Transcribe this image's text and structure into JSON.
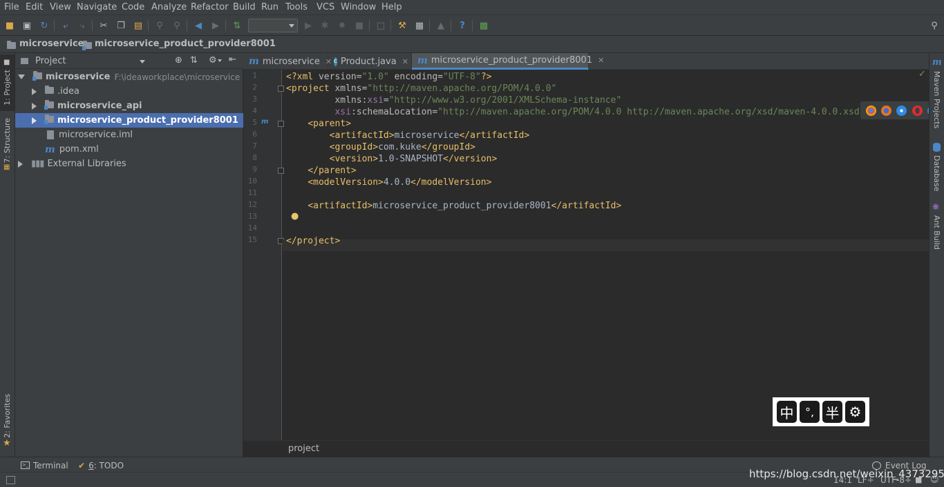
{
  "menu": [
    "File",
    "Edit",
    "View",
    "Navigate",
    "Code",
    "Analyze",
    "Refactor",
    "Build",
    "Run",
    "Tools",
    "VCS",
    "Window",
    "Help"
  ],
  "toolbar": {
    "run_config_value": ""
  },
  "navbar": {
    "crumbs": [
      "microservice",
      "microservice_product_provider8001"
    ]
  },
  "left_tabs": {
    "project": "1: Project",
    "structure": "7: Structure",
    "favorites": "2: Favorites"
  },
  "project_panel": {
    "title": "Project",
    "tree": [
      {
        "name": "microservice",
        "detail": "F:\\ideaworkplace\\microservice"
      },
      {
        "name": ".idea"
      },
      {
        "name": "microservice_api"
      },
      {
        "name": "microservice_product_provider8001"
      },
      {
        "name": "microservice.iml"
      },
      {
        "name": "pom.xml"
      },
      {
        "name": "External Libraries"
      }
    ]
  },
  "editor": {
    "tabs": [
      {
        "label": "microservice",
        "icon": "maven-icon"
      },
      {
        "label": "Product.java",
        "icon": "class-icon"
      },
      {
        "label": "microservice_product_provider8001",
        "icon": "maven-icon"
      }
    ],
    "line_numbers": [
      "1",
      "2",
      "3",
      "4",
      "5",
      "6",
      "7",
      "8",
      "9",
      "10",
      "11",
      "12",
      "13",
      "14",
      "15"
    ],
    "breadcrumb": "project"
  },
  "right_tabs": {
    "maven": "Maven Projects",
    "database": "Database",
    "ant": "Ant Build"
  },
  "bottom": {
    "terminal": "Terminal",
    "todo_num": "6",
    "todo_label": ": TODO",
    "event_log": "Event Log"
  },
  "status": {
    "position": "14:1",
    "line_sep": "LF÷",
    "encoding": "UTF-8÷"
  },
  "watermark": "https://blog.csdn.net/weixin_43732955",
  "ime": {
    "k1": "中",
    "k2": "°,",
    "k3": "半"
  },
  "colors": {
    "selection": "#4b6eaf",
    "accent": "#4a88c7",
    "tag": "#e8bf6a",
    "string": "#6a8759",
    "namespace": "#9876aa"
  }
}
